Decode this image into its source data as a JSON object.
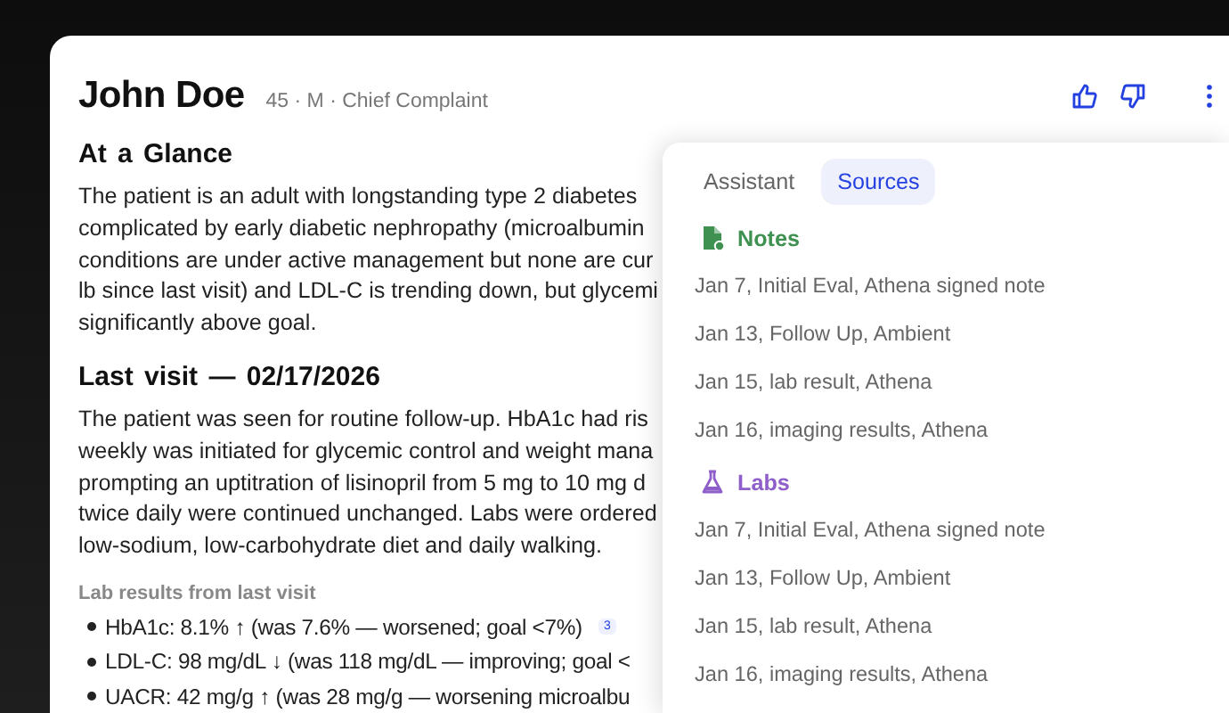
{
  "patient": {
    "name": "John Doe",
    "meta": "45 · M · Chief Complaint"
  },
  "actions": [
    {
      "kind": "thumbs_up"
    },
    {
      "kind": "thumbs_down"
    },
    {
      "kind": "more"
    }
  ],
  "sections": [
    {
      "heading": "At a Glance",
      "lines": [
        "The patient is an adult with longstanding type 2 diabetes",
        "complicated by early diabetic nephropathy (microalbumin",
        "conditions are under active management but none are cur",
        "lb since last visit) and LDL-C is trending down, but glycemi",
        "significantly above goal."
      ]
    },
    {
      "heading": "Last visit — 02/17/2026",
      "lines": [
        "The patient was seen for routine follow-up. HbA1c had ris",
        "weekly was initiated for glycemic control and weight mana",
        "prompting an uptitration of lisinopril from 5 mg to 10 mg d",
        "twice daily were continued unchanged. Labs were ordered",
        "low-sodium, low-carbohydrate diet and daily walking."
      ],
      "lab_results": {
        "label": "Lab results from last visit",
        "items": [
          {
            "text": "HbA1c: 8.1% ↑ (was 7.6% — worsened; goal <7%)",
            "citation": "3"
          },
          {
            "text": "LDL-C: 98 mg/dL ↓ (was 118 mg/dL — improving; goal <"
          },
          {
            "text": "UACR: 42 mg/g ↑ (was 28 mg/g — worsening microalbu"
          }
        ]
      }
    }
  ],
  "panel": {
    "tabs": [
      {
        "label": "Assistant",
        "selected": false
      },
      {
        "label": "Sources",
        "selected": true
      }
    ],
    "groups": [
      {
        "kind": "notes",
        "title": "Notes",
        "color": "#3e9150",
        "items": [
          "Jan 7, Initial Eval, Athena signed note",
          "Jan 13, Follow Up, Ambient",
          "Jan 15, lab result, Athena",
          "Jan 16, imaging results, Athena"
        ]
      },
      {
        "kind": "labs",
        "title": "Labs",
        "color": "#8e5fc9",
        "items": [
          "Jan 7, Initial Eval, Athena signed note",
          "Jan 13, Follow Up, Ambient",
          "Jan 15, lab result, Athena",
          "Jan 16, imaging results, Athena"
        ]
      }
    ]
  }
}
